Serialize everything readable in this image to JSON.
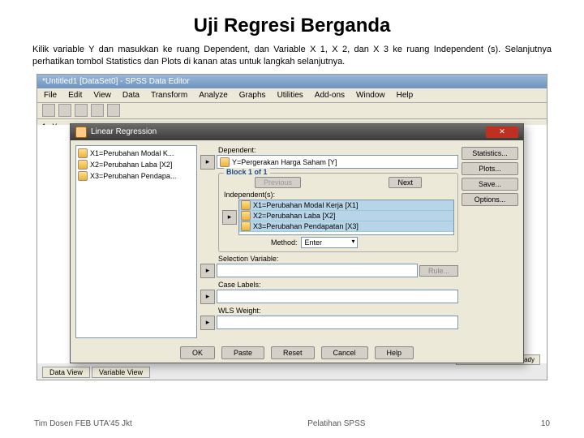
{
  "slide": {
    "title": "Uji Regresi Berganda",
    "description": "Kilik variable Y dan masukkan ke ruang Dependent, dan Variable X 1, X 2, dan X 3 ke ruang Independent (s). Selanjutnya perhatikan tombol Statistics dan Plots di kanan atas untuk langkah selanjutnya."
  },
  "spss": {
    "window_title": "*Untitled1 [DataSet0] - SPSS Data Editor",
    "menu": [
      "File",
      "Edit",
      "View",
      "Data",
      "Transform",
      "Analyze",
      "Graphs",
      "Utilities",
      "Add-ons",
      "Window",
      "Help"
    ],
    "toolbar_rownum": "1 : Y",
    "tabs": [
      "Data View",
      "Variable View"
    ],
    "status": "SPSS Processor is ready"
  },
  "dialog": {
    "title": "Linear Regression",
    "source_vars": [
      "X1=Perubahan Modal K...",
      "X2=Perubahan Laba [X2]",
      "X3=Perubahan Pendapa..."
    ],
    "dependent_label": "Dependent:",
    "dependent_value": "Y=Pergerakan Harga Saham [Y]",
    "block_title": "Block 1 of 1",
    "buttons_block": {
      "previous": "Previous",
      "next": "Next"
    },
    "independent_label": "Independent(s):",
    "independent_values": [
      "X1=Perubahan Modal Kerja [X1]",
      "X2=Perubahan Laba [X2]",
      "X3=Perubahan Pendapatan [X3]"
    ],
    "method_label": "Method:",
    "method_value": "Enter",
    "selection_label": "Selection Variable:",
    "rule_button": "Rule...",
    "case_label": "Case Labels:",
    "wls_label": "WLS Weight:",
    "right_buttons": [
      "Statistics...",
      "Plots...",
      "Save...",
      "Options..."
    ],
    "bottom_buttons": [
      "OK",
      "Paste",
      "Reset",
      "Cancel",
      "Help"
    ]
  },
  "footer": {
    "left": "Tim Dosen FEB UTA'45 Jkt",
    "center": "Pelatihan SPSS",
    "right": "10"
  }
}
